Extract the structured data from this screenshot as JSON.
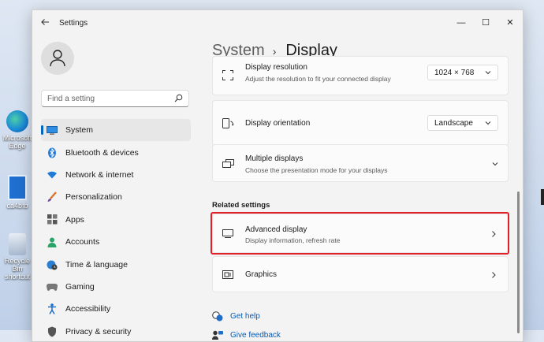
{
  "desktop": {
    "icons": [
      {
        "label": "Microsoft Edge",
        "name": "edge"
      },
      {
        "label": "ca4bfb",
        "name": "file"
      },
      {
        "label": "Recycle Bin shortcut",
        "name": "recycle-bin"
      }
    ]
  },
  "window": {
    "title": "Settings",
    "controls": {
      "minimize": "—",
      "maximize": "☐",
      "close": "✕"
    }
  },
  "sidebar": {
    "search_placeholder": "Find a setting",
    "items": [
      {
        "label": "System",
        "icon": "monitor-icon",
        "active": true
      },
      {
        "label": "Bluetooth & devices",
        "icon": "bluetooth-icon"
      },
      {
        "label": "Network & internet",
        "icon": "wifi-icon"
      },
      {
        "label": "Personalization",
        "icon": "brush-icon"
      },
      {
        "label": "Apps",
        "icon": "apps-icon"
      },
      {
        "label": "Accounts",
        "icon": "person-icon"
      },
      {
        "label": "Time & language",
        "icon": "globe-clock-icon"
      },
      {
        "label": "Gaming",
        "icon": "gamepad-icon"
      },
      {
        "label": "Accessibility",
        "icon": "accessibility-icon"
      },
      {
        "label": "Privacy & security",
        "icon": "shield-icon"
      }
    ]
  },
  "breadcrumb": {
    "parent": "System",
    "separator": "›",
    "current": "Display"
  },
  "main": {
    "display_resolution": {
      "title": "Display resolution",
      "subtitle": "Adjust the resolution to fit your connected display",
      "value": "1024 × 768"
    },
    "display_orientation": {
      "title": "Display orientation",
      "value": "Landscape"
    },
    "multiple_displays": {
      "title": "Multiple displays",
      "subtitle": "Choose the presentation mode for your displays"
    },
    "related_settings_label": "Related settings",
    "advanced_display": {
      "title": "Advanced display",
      "subtitle": "Display information, refresh rate"
    },
    "graphics": {
      "title": "Graphics"
    },
    "links": {
      "get_help": "Get help",
      "give_feedback": "Give feedback"
    }
  },
  "colors": {
    "accent": "#0067c0",
    "highlight": "#e01f2a",
    "link": "#0a5bb0"
  }
}
